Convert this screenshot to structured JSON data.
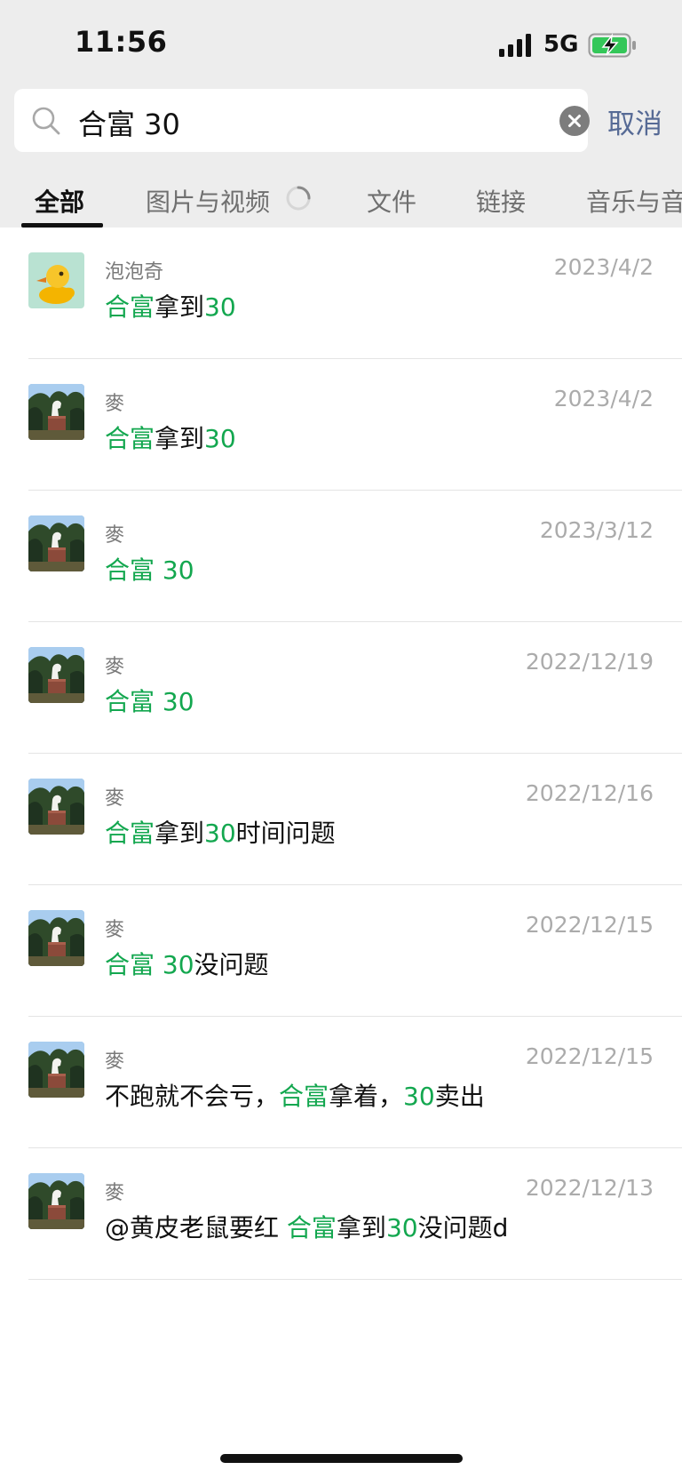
{
  "status_bar": {
    "time": "11:56",
    "network": "5G"
  },
  "search": {
    "query": "合富 30",
    "cancel_label": "取消"
  },
  "tabs": [
    {
      "label": "全部",
      "active": true
    },
    {
      "label": "图片与视频",
      "active": false
    },
    {
      "label": "文件",
      "active": false
    },
    {
      "label": "链接",
      "active": false
    },
    {
      "label": "音乐与音",
      "active": false
    }
  ],
  "highlight_color": "#13a74f",
  "results": [
    {
      "name": "泡泡奇",
      "date": "2023/4/2",
      "avatar": "duck",
      "message": [
        {
          "text": "合富",
          "hl": true
        },
        {
          "text": "拿到",
          "hl": false
        },
        {
          "text": "30",
          "hl": true
        }
      ]
    },
    {
      "name": "麥",
      "date": "2023/4/2",
      "avatar": "statue",
      "message": [
        {
          "text": "合富",
          "hl": true
        },
        {
          "text": "拿到",
          "hl": false
        },
        {
          "text": "30",
          "hl": true
        }
      ]
    },
    {
      "name": "麥",
      "date": "2023/3/12",
      "avatar": "statue",
      "message": [
        {
          "text": "合富 ",
          "hl": true
        },
        {
          "text": "30",
          "hl": true
        }
      ]
    },
    {
      "name": "麥",
      "date": "2022/12/19",
      "avatar": "statue",
      "message": [
        {
          "text": "合富 ",
          "hl": true
        },
        {
          "text": "30",
          "hl": true
        }
      ]
    },
    {
      "name": "麥",
      "date": "2022/12/16",
      "avatar": "statue",
      "message": [
        {
          "text": "合富",
          "hl": true
        },
        {
          "text": "拿到",
          "hl": false
        },
        {
          "text": "30",
          "hl": true
        },
        {
          "text": "时间问题",
          "hl": false
        }
      ]
    },
    {
      "name": "麥",
      "date": "2022/12/15",
      "avatar": "statue",
      "message": [
        {
          "text": "合富 ",
          "hl": true
        },
        {
          "text": "30",
          "hl": true
        },
        {
          "text": "没问题",
          "hl": false
        }
      ]
    },
    {
      "name": "麥",
      "date": "2022/12/15",
      "avatar": "statue",
      "message": [
        {
          "text": "不跑就不会亏，",
          "hl": false
        },
        {
          "text": "合富",
          "hl": true
        },
        {
          "text": "拿着，",
          "hl": false
        },
        {
          "text": "30",
          "hl": true
        },
        {
          "text": "卖出",
          "hl": false
        }
      ]
    },
    {
      "name": "麥",
      "date": "2022/12/13",
      "avatar": "statue",
      "message": [
        {
          "text": "@黄皮老鼠要红 ",
          "hl": false
        },
        {
          "text": "合富",
          "hl": true
        },
        {
          "text": "拿到",
          "hl": false
        },
        {
          "text": "30",
          "hl": true
        },
        {
          "text": "没问题d",
          "hl": false
        }
      ]
    }
  ]
}
